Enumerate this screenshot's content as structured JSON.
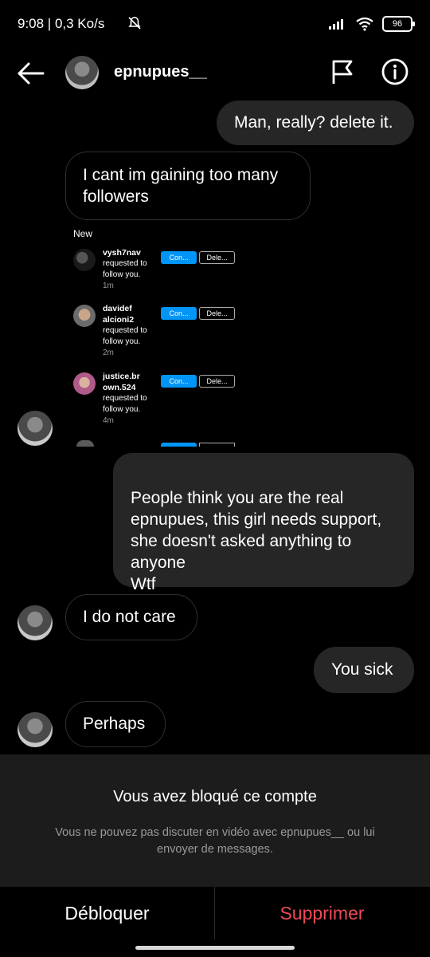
{
  "status": {
    "time_speed": "9:08 | 0,3 Ko/s",
    "battery": "96"
  },
  "header": {
    "username": "epnupues__",
    "icons": [
      "back-arrow-icon",
      "flag-icon",
      "info-icon"
    ]
  },
  "messages": [
    {
      "side": "out",
      "text": "Man, really? delete it."
    },
    {
      "side": "in",
      "text": "I cant im gaining too many followers"
    },
    {
      "side": "out",
      "text": "People think you are the real epnupues, this girl needs support, she doesn't asked anything to anyone\nWtf"
    },
    {
      "side": "in",
      "text": "I do not care"
    },
    {
      "side": "out",
      "text": "You sick"
    },
    {
      "side": "in",
      "text": "Perhaps"
    }
  ],
  "screenshot": {
    "section_label": "New",
    "confirm_label": "Con...",
    "delete_label": "Dele...",
    "requests": [
      {
        "username": "vysh7nav",
        "text": "requested to follow you.",
        "time": "1m"
      },
      {
        "username": "davidef alcioni2",
        "text": "requested to follow you.",
        "time": "2m"
      },
      {
        "username": "justice.br own.524",
        "text": "requested to follow you.",
        "time": "4m"
      }
    ]
  },
  "blocked": {
    "title": "Vous avez bloqué ce compte",
    "subtitle": "Vous ne pouvez pas discuter en vidéo avec epnupues__ ou lui envoyer de messages."
  },
  "actions": {
    "unblock": "Débloquer",
    "delete": "Supprimer"
  },
  "colors": {
    "background": "#000000",
    "bubble_out": "#262626",
    "panel": "#1c1c1c",
    "destructive": "#ed4956",
    "confirm_blue": "#0095f6"
  }
}
